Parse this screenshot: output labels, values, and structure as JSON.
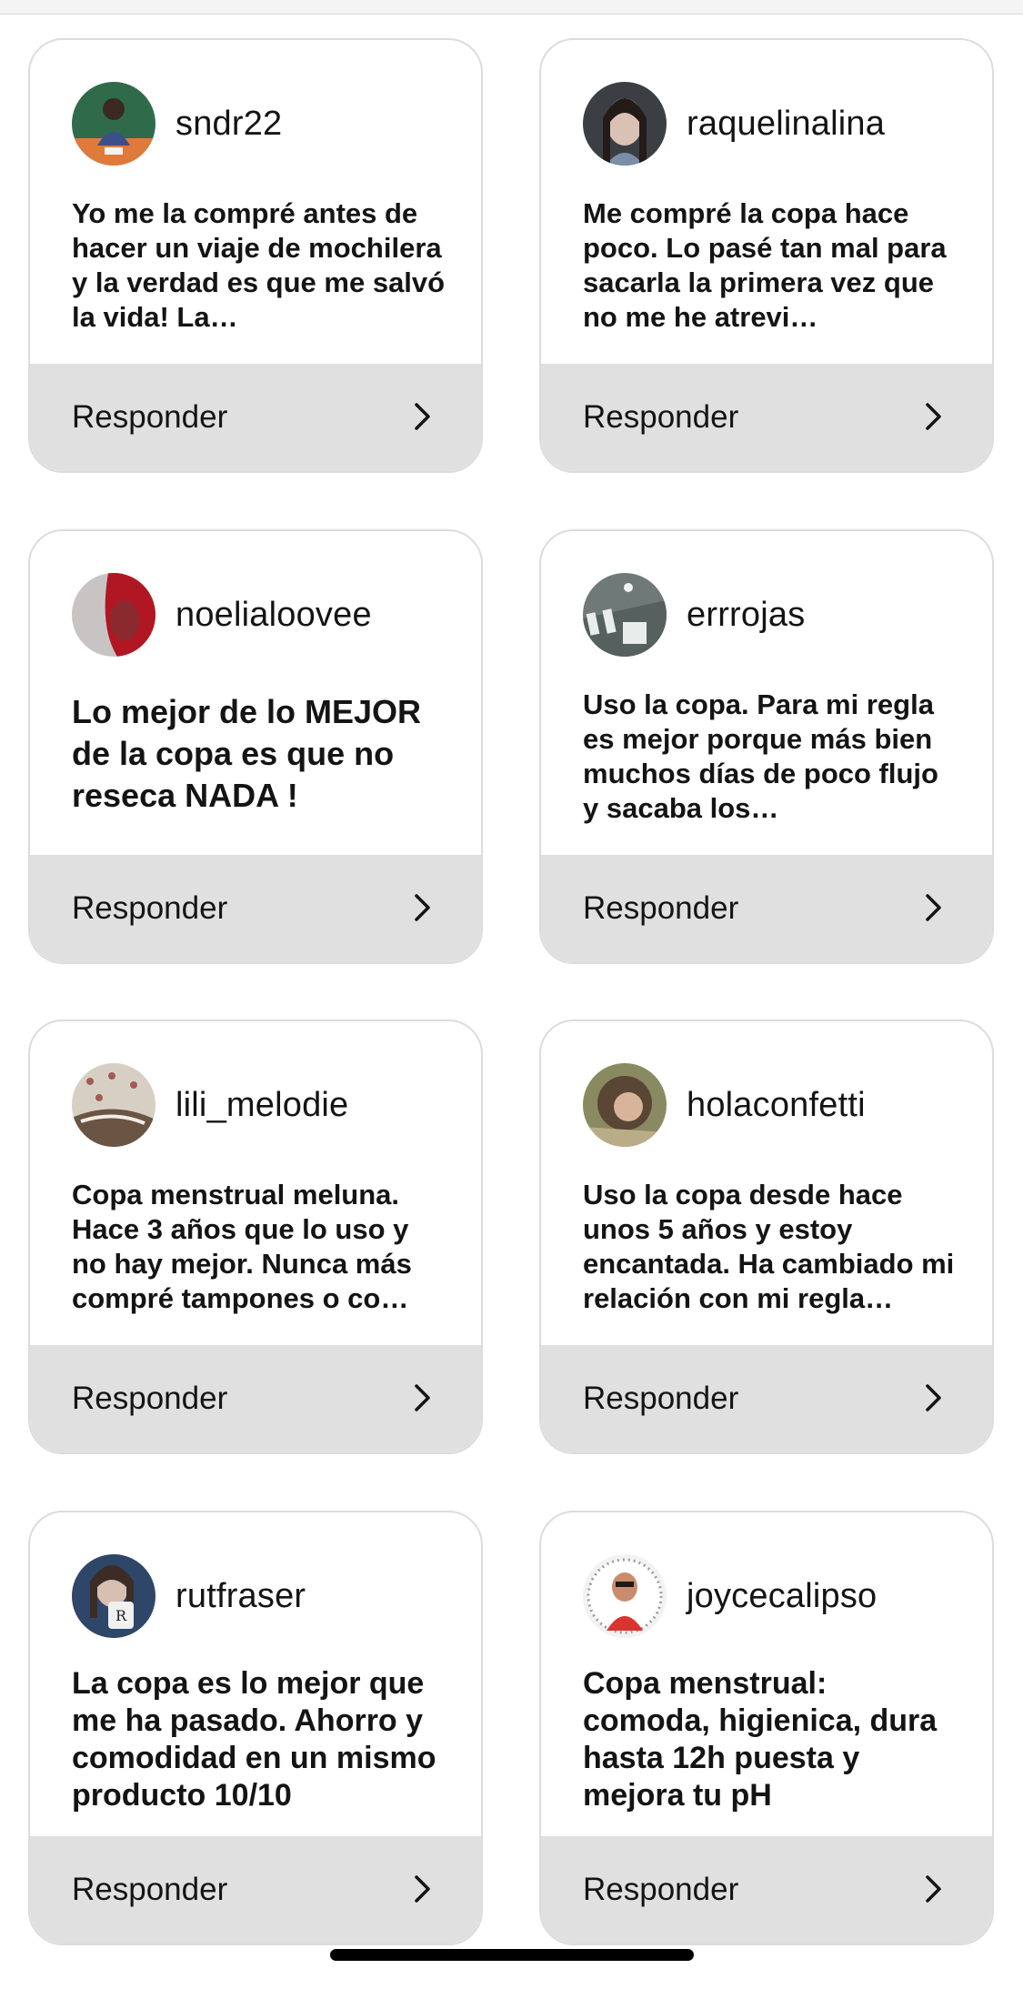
{
  "reply_label": "Responder",
  "posts": [
    {
      "username": "sndr22",
      "text": "Yo me la compré antes de hacer un viaje de mochilera y la verdad es que me salvó la vida! La…"
    },
    {
      "username": "raquelinalina",
      "text": "Me compré la copa hace poco. Lo pasé tan mal para sacarla la primera vez que no me he atrevi…"
    },
    {
      "username": "noelialoovee",
      "text": "Lo mejor de lo MEJOR de la copa es que no reseca NADA !"
    },
    {
      "username": "errrojas",
      "text": "Uso la copa. Para mi regla es mejor porque más bien muchos días de poco flujo y sacaba los…"
    },
    {
      "username": "lili_melodie",
      "text": "Copa menstrual meluna. Hace 3 años que lo uso y no hay mejor. Nunca más compré tampones o co…"
    },
    {
      "username": "holaconfetti",
      "text": "Uso la copa desde hace unos 5 años y estoy encantada. Ha cambiado mi relación con mi regla…"
    },
    {
      "username": "rutfraser",
      "text": "La copa es lo mejor que me ha pasado. Ahorro y comodidad en un mismo producto 10/10"
    },
    {
      "username": "joycecalipso",
      "text": "Copa menstrual: comoda, higienica, dura hasta 12h puesta y mejora tu pH"
    }
  ]
}
